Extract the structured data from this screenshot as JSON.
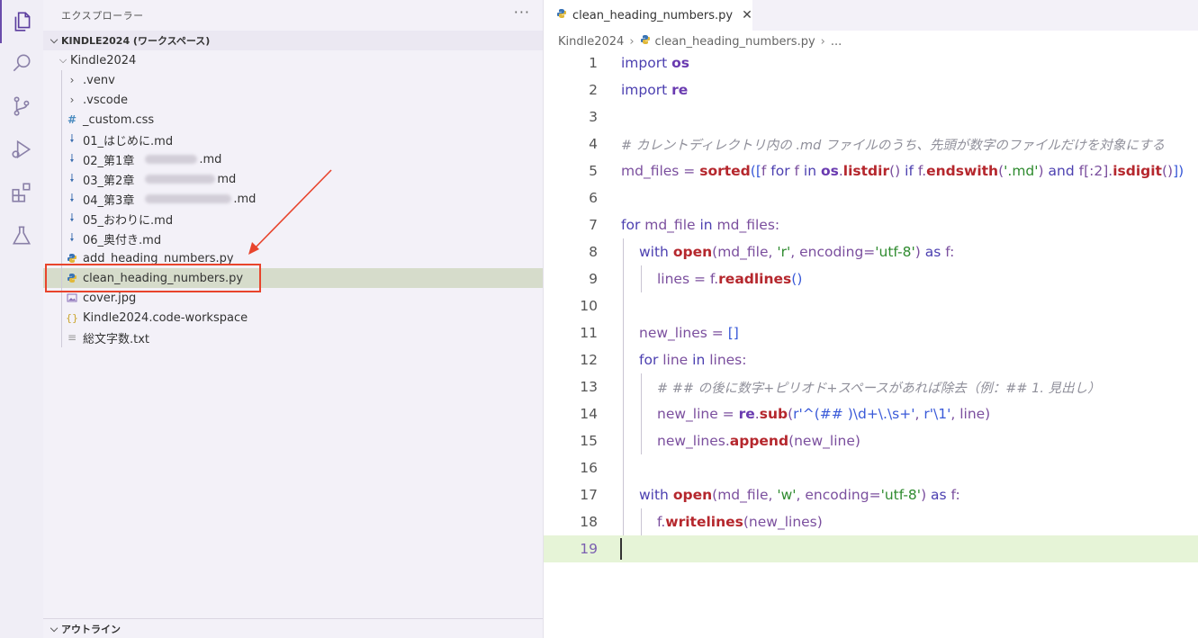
{
  "sidebar": {
    "title": "エクスプローラー",
    "more": "···",
    "workspace": "KINDLE2024 (ワークスペース)",
    "folder": "Kindle2024",
    "items": [
      {
        "label": ".venv",
        "icon": "chevron-right-icon"
      },
      {
        "label": ".vscode",
        "icon": "chevron-right-icon"
      },
      {
        "label": "_custom.css",
        "icon": "css-file-icon"
      },
      {
        "label": "01_はじめに.md",
        "icon": "markdown-file-icon"
      },
      {
        "label": "02_第1章",
        "suffix": ".md",
        "icon": "markdown-file-icon"
      },
      {
        "label": "03_第2章",
        "suffix": "md",
        "icon": "markdown-file-icon"
      },
      {
        "label": "04_第3章",
        "suffix": ".md",
        "icon": "markdown-file-icon"
      },
      {
        "label": "05_おわりに.md",
        "icon": "markdown-file-icon"
      },
      {
        "label": "06_奥付き.md",
        "icon": "markdown-file-icon"
      },
      {
        "label": "add_heading_numbers.py",
        "icon": "python-file-icon"
      },
      {
        "label": "clean_heading_numbers.py",
        "icon": "python-file-icon"
      },
      {
        "label": "cover.jpg",
        "icon": "image-file-icon"
      },
      {
        "label": "Kindle2024.code-workspace",
        "icon": "json-file-icon"
      },
      {
        "label": "総文字数.txt",
        "icon": "text-file-icon"
      }
    ],
    "outline": "アウトライン"
  },
  "editor": {
    "tab_label": "clean_heading_numbers.py",
    "breadcrumb": [
      "Kindle2024",
      "clean_heading_numbers.py",
      "..."
    ],
    "current_line": 19,
    "line_numbers": [
      "1",
      "2",
      "3",
      "4",
      "5",
      "6",
      "7",
      "8",
      "9",
      "10",
      "11",
      "12",
      "13",
      "14",
      "15",
      "16",
      "17",
      "18",
      "19"
    ],
    "code": {
      "l1": [
        "import",
        "os"
      ],
      "l2": [
        "import",
        "re"
      ],
      "l4": "# カレントディレクトリ内の .md ファイルのうち、先頭が数字のファイルだけを対象にする",
      "l5": [
        "md_files",
        " = ",
        "sorted",
        "([",
        "f",
        " for ",
        "f",
        " in ",
        "os",
        ".",
        "listdir",
        "()",
        " if ",
        "f",
        ".",
        "endswith",
        "(",
        "'.md'",
        ")",
        " and ",
        "f",
        "[:2].",
        "isdigit",
        "()",
        "])"
      ],
      "l7": [
        "for",
        " md_file ",
        "in",
        " md_files:"
      ],
      "l8": [
        "with",
        " ",
        "open",
        "(",
        "md_file, ",
        "'r'",
        ", encoding=",
        "'utf-8'",
        ") ",
        "as",
        " f:"
      ],
      "l9": [
        "lines = f.",
        "readlines",
        "()"
      ],
      "l11": [
        "new_lines = ",
        "[]"
      ],
      "l12": [
        "for",
        " line ",
        "in",
        " lines:"
      ],
      "l13": "# ## の後に数字+ピリオド+スペースがあれば除去（例：## 1. 見出し）",
      "l14": [
        "new_line = ",
        "re",
        ".",
        "sub",
        "(",
        "r'^(## )\\d+\\.\\s+'",
        ", ",
        "r'\\1'",
        ", line)"
      ],
      "l15": [
        "new_lines.",
        "append",
        "(new_line)"
      ],
      "l17": [
        "with",
        " ",
        "open",
        "(",
        "md_file, ",
        "'w'",
        ", encoding=",
        "'utf-8'",
        ") ",
        "as",
        " f:"
      ],
      "l18": [
        "f.",
        "writelines",
        "(new_lines)"
      ]
    }
  },
  "colors": {
    "keyword": "#4b3fb0",
    "function": "#b5272d",
    "string": "#2f8b2f",
    "comment": "#8f8f9a",
    "selection": "#d6dccb",
    "current_line": "#e6f4d7",
    "annotation": "#e8442c"
  }
}
